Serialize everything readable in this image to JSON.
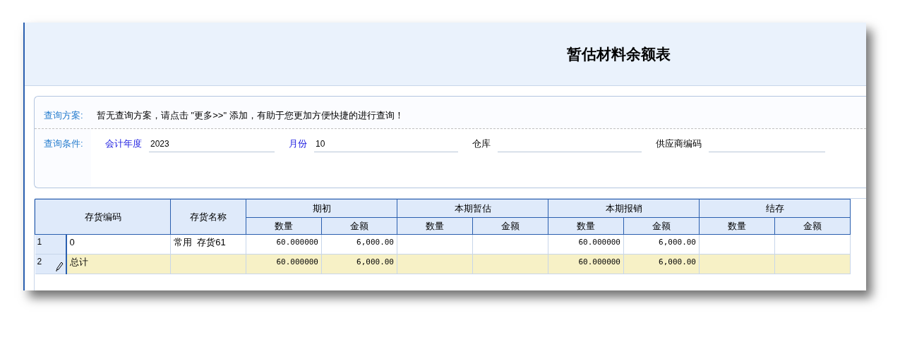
{
  "title": "暂估材料余额表",
  "query_scheme": {
    "label": "查询方案:",
    "message": "暂无查询方案，请点击 \"更多>>\" 添加，有助于您更加方便快捷的进行查询！"
  },
  "query_conditions": {
    "label": "查询条件:",
    "fields": [
      {
        "label": "会计年度",
        "value": "2023",
        "highlighted": true
      },
      {
        "label": "月份",
        "value": "10",
        "highlighted": true
      },
      {
        "label": "仓库",
        "highlighted": false
      },
      {
        "label": "供应商编码",
        "highlighted": false
      }
    ]
  },
  "table": {
    "columns": [
      "存货编码",
      "存货名称"
    ],
    "groups": [
      {
        "label": "期初",
        "columns": [
          "数量",
          "金额"
        ]
      },
      {
        "label": "本期暂估",
        "columns": [
          "数量",
          "金额"
        ]
      },
      {
        "label": "本期报销",
        "columns": [
          "数量",
          "金额"
        ]
      },
      {
        "label": "结存",
        "columns": [
          "数量",
          "金额"
        ]
      }
    ],
    "rows": [
      {
        "kind": "data",
        "number": "1",
        "editing": false,
        "cells": [
          "0",
          "常用  存货61",
          "60.000000",
          "6,000.00",
          "",
          "",
          "60.000000",
          "6,000.00",
          "",
          ""
        ]
      },
      {
        "kind": "total",
        "number": "2",
        "editing": true,
        "cells": [
          "总计",
          "",
          "60.000000",
          "6,000.00",
          "",
          "",
          "60.000000",
          "6,000.00",
          "",
          ""
        ]
      }
    ]
  }
}
